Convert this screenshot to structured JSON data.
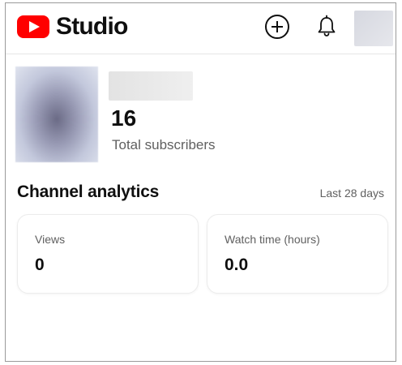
{
  "app": {
    "title": "Studio"
  },
  "header": {
    "create_icon": "plus-circle-icon",
    "notifications_icon": "bell-icon"
  },
  "channel": {
    "subscriber_count": "16",
    "subscriber_label": "Total subscribers"
  },
  "analytics": {
    "title": "Channel analytics",
    "period": "Last 28 days",
    "cards": [
      {
        "label": "Views",
        "value": "0"
      },
      {
        "label": "Watch time (hours)",
        "value": "0.0"
      }
    ]
  },
  "colors": {
    "brand_red": "#ff0000",
    "text_primary": "#0f0f0f",
    "text_secondary": "#606060"
  }
}
